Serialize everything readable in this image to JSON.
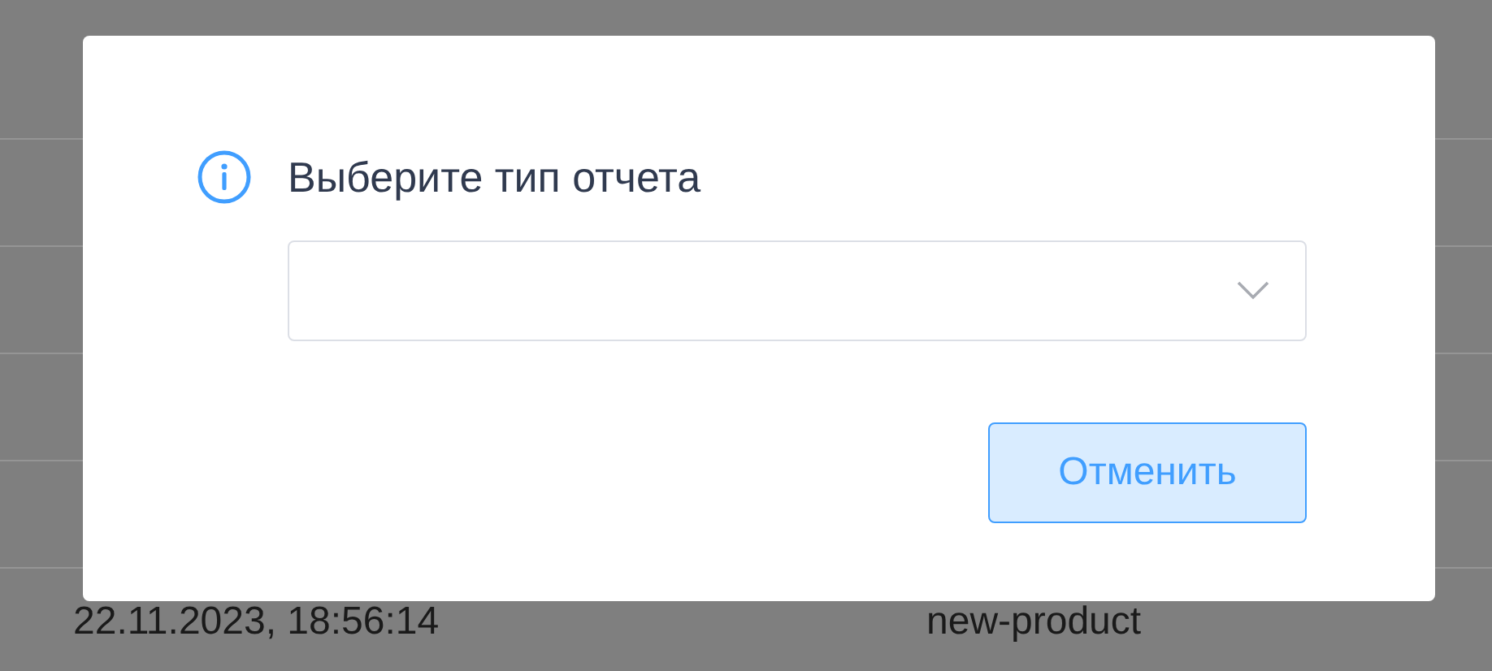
{
  "table": {
    "rows": [
      {
        "date": "22.11.2023, 18:56:14",
        "name": "new-product"
      }
    ]
  },
  "dialog": {
    "title": "Выберите тип отчета",
    "cancel_button": "Отменить"
  }
}
